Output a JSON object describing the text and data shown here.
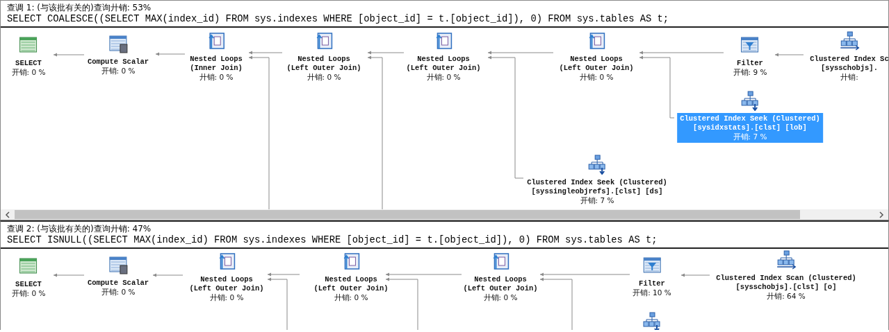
{
  "plans": [
    {
      "title": "查调 1: (与该批有关的)查询廾销: 53%",
      "sql": "SELECT COALESCE((SELECT MAX(index_id) FROM sys.indexes WHERE [object_id] = t.[object_id]), 0) FROM sys.tables AS t;",
      "horizontal_scrollbar": true,
      "nodes": [
        {
          "kind": "select",
          "name": "SELECT",
          "cost": "开销: 0 %",
          "selected": false
        },
        {
          "kind": "compute_scalar",
          "name": "Compute Scalar",
          "cost": "开销: 0 %",
          "selected": false
        },
        {
          "kind": "nested_loops",
          "name": "Nested Loops",
          "detail": "(Inner Join)",
          "cost": "廾销: 0 %",
          "selected": false
        },
        {
          "kind": "nested_loops",
          "name": "Nested Loops",
          "detail": "(Left Outer Join)",
          "cost": "廾销: 0 %",
          "selected": false
        },
        {
          "kind": "nested_loops",
          "name": "Nested Loops",
          "detail": "(Left Outer Join)",
          "cost": "廾销: 0 %",
          "selected": false
        },
        {
          "kind": "nested_loops",
          "name": "Nested Loops",
          "detail": "(Left Outer Join)",
          "cost": "廾销: 0 %",
          "selected": false
        },
        {
          "kind": "filter",
          "name": "Filter",
          "cost": "开销: 9 %",
          "selected": false
        },
        {
          "kind": "index_scan",
          "name": "Clustered Index Sc",
          "detail": "[sysschobjs].",
          "cost": "廾销:",
          "selected": false
        },
        {
          "kind": "index_seek",
          "name": "Clustered Index Seek (Clustered)",
          "detail": "[sysidxstats].[clst] [lob]",
          "cost": "开销: 7 %",
          "selected": true
        },
        {
          "kind": "index_seek",
          "name": "Clustered Index Seek (Clustered)",
          "detail": "[syssingleobjrefs].[clst] [ds]",
          "cost": "开销: 7 %",
          "selected": false
        }
      ]
    },
    {
      "title": "查调 2: (与该批有关的)查询廾销: 47%",
      "sql": "SELECT ISNULL((SELECT MAX(index_id) FROM sys.indexes WHERE [object_id] = t.[object_id]), 0) FROM sys.tables AS t;",
      "horizontal_scrollbar": false,
      "nodes": [
        {
          "kind": "select",
          "name": "SELECT",
          "cost": "开销: 0 %",
          "selected": false
        },
        {
          "kind": "compute_scalar",
          "name": "Compute Scalar",
          "cost": "开销: 0 %",
          "selected": false
        },
        {
          "kind": "nested_loops",
          "name": "Nested Loops",
          "detail": "(Left Outer Join)",
          "cost": "廾销: 0 %",
          "selected": false
        },
        {
          "kind": "nested_loops",
          "name": "Nested Loops",
          "detail": "(Left Outer Join)",
          "cost": "廾销: 0 %",
          "selected": false
        },
        {
          "kind": "nested_loops",
          "name": "Nested Loops",
          "detail": "(Left Outer Join)",
          "cost": "廾销: 0 %",
          "selected": false
        },
        {
          "kind": "filter",
          "name": "Filter",
          "cost": "开销: 10 %",
          "selected": false
        },
        {
          "kind": "index_scan",
          "name": "Clustered Index Scan (Clustered)",
          "detail": "[sysschobjs].[clst] [o]",
          "cost": "廾销: 64 %",
          "selected": false
        },
        {
          "kind": "index_seek",
          "selected": false
        }
      ]
    }
  ]
}
